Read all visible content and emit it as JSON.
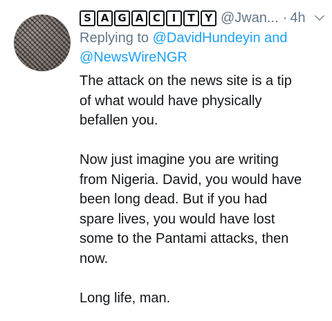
{
  "tweet": {
    "display_name_letters": [
      "S",
      "A",
      "G",
      "A",
      "C",
      "I",
      "T",
      "Y"
    ],
    "handle": "@Jwan...",
    "separator": "·",
    "time": "4h",
    "reply": {
      "prefix": "Replying to",
      "mention_1": "@DavidHundeyin",
      "joiner": "and",
      "mention_2": "@NewsWireNGR"
    },
    "paragraphs": [
      [
        "The attack on the news site is a tip",
        "of what would have physically",
        "befallen you."
      ],
      [
        "Now just imagine you are writing",
        "from Nigeria. David, you would have",
        "been long dead. But if you had",
        "spare lives, you would have lost",
        "some to the Pantami attacks, then",
        "now."
      ],
      [
        "Long life, man."
      ]
    ]
  },
  "icons": {
    "menu": "chevron-down-icon",
    "avatar": "user-avatar"
  },
  "colors": {
    "text": "#14171a",
    "secondary": "#657786",
    "link": "#1da1f2",
    "icon": "#8899a6"
  }
}
